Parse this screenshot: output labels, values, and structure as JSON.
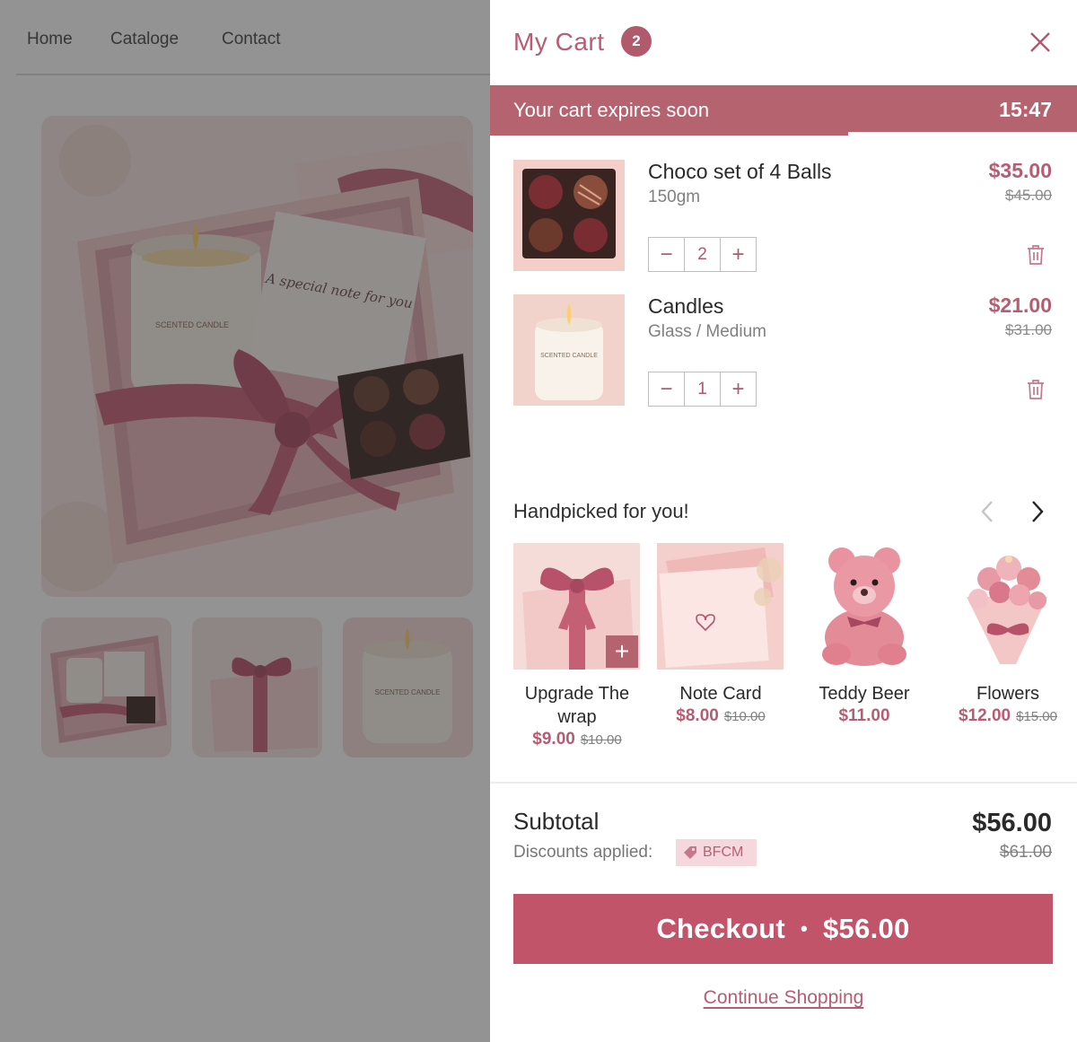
{
  "nav": {
    "home": "Home",
    "catalog": "Cataloge",
    "contact": "Contact"
  },
  "product_image_text": {
    "candle": "SCENTED CANDLE",
    "note": "A special note for you"
  },
  "cart": {
    "title": "My Cart",
    "count": "2",
    "expiry_text": "Your cart expires soon",
    "expiry_time": "15:47",
    "expiry_progress": 0.61,
    "items": [
      {
        "name": "Choco set of 4 Balls",
        "variant": "150gm",
        "price": "$35.00",
        "compare": "$45.00",
        "qty": "2",
        "minus": "−",
        "plus": "+"
      },
      {
        "name": "Candles",
        "variant": "Glass / Medium",
        "price": "$21.00",
        "compare": "$31.00",
        "qty": "1",
        "minus": "−",
        "plus": "+"
      }
    ]
  },
  "handpicked": {
    "title": "Handpicked for you!",
    "products": [
      {
        "name": "Upgrade The wrap",
        "price": "$9.00",
        "compare": "$10.00",
        "add": "+"
      },
      {
        "name": "Note Card",
        "price": "$8.00",
        "compare": "$10.00"
      },
      {
        "name": "Teddy Beer",
        "price": "$11.00",
        "compare": ""
      },
      {
        "name": "Flowers",
        "price": "$12.00",
        "compare": "$15.00"
      }
    ]
  },
  "summary": {
    "subtotal_label": "Subtotal",
    "subtotal": "$56.00",
    "subtotal_compare": "$61.00",
    "discounts_label": "Discounts applied:",
    "discount_code": "BFCM"
  },
  "checkout": {
    "label": "Checkout",
    "separator": "•",
    "amount": "$56.00"
  },
  "continue_label": "Continue Shopping",
  "colors": {
    "accent": "#b85c72",
    "button": "#c2546a",
    "banner": "#b5636f",
    "tag_bg": "#f5d7dd"
  }
}
